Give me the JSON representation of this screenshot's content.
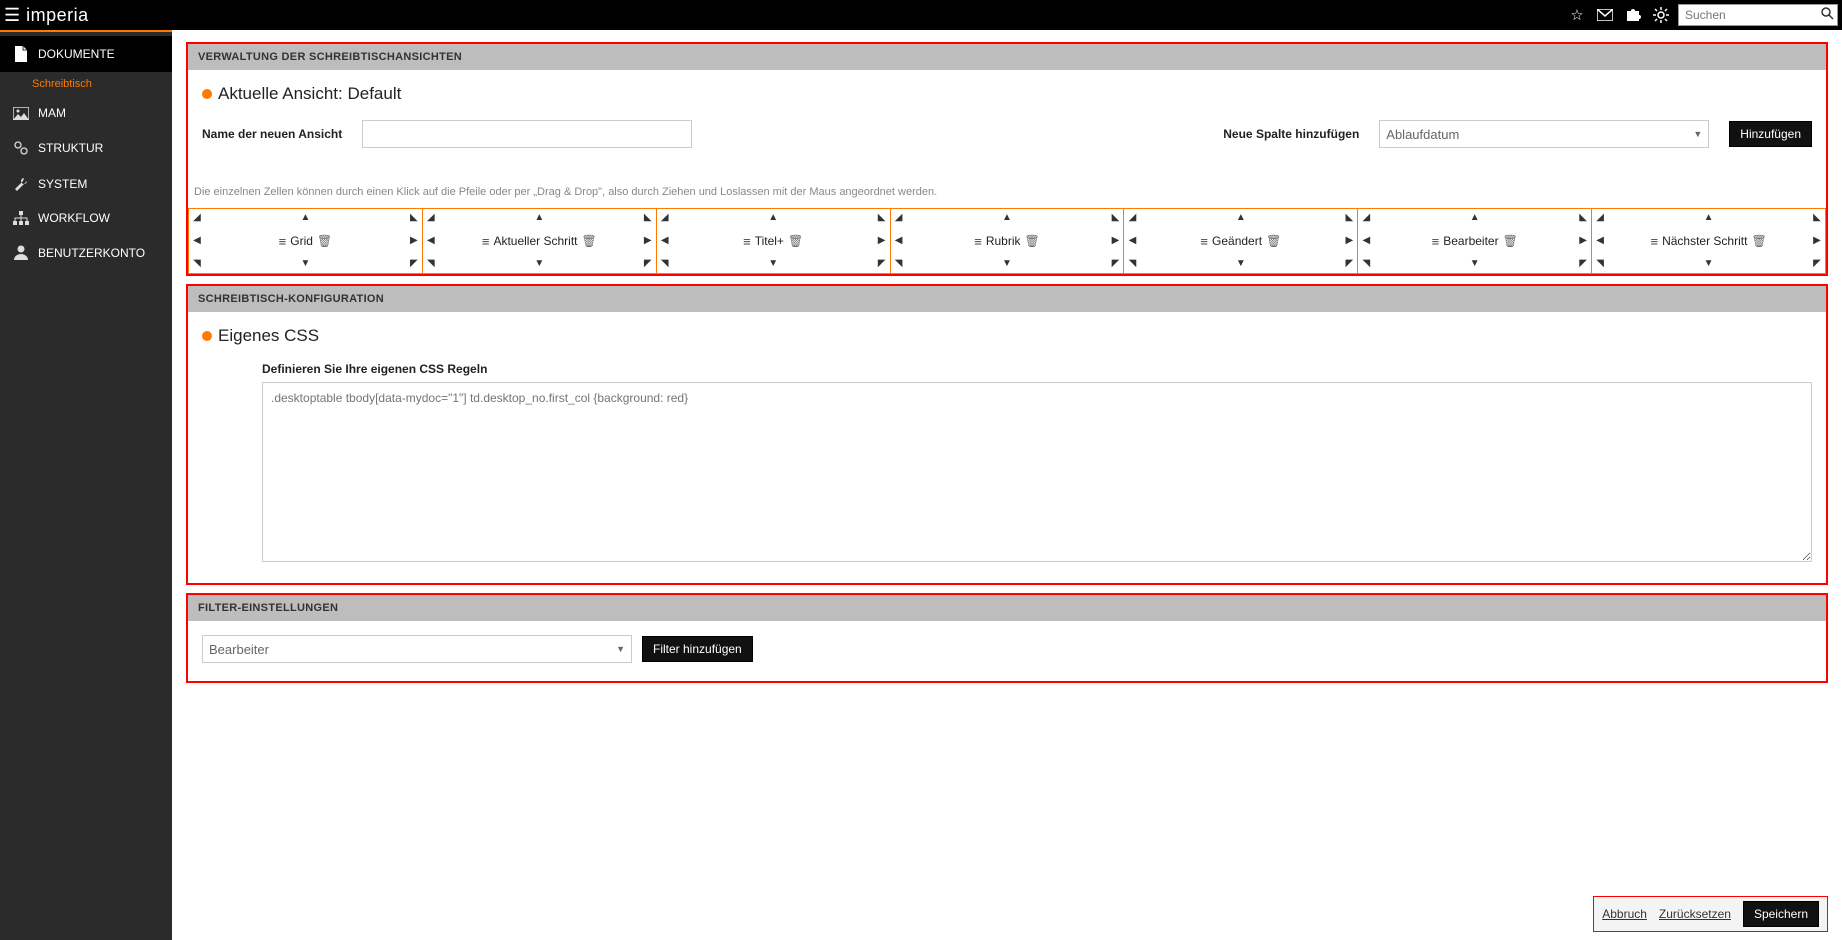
{
  "topbar": {
    "logo": "imperia",
    "search_placeholder": "Suchen"
  },
  "sidebar": {
    "items": [
      {
        "label": "DOKUMENTE",
        "active": true,
        "sub": [
          {
            "label": "Schreibtisch"
          }
        ]
      },
      {
        "label": "MAM"
      },
      {
        "label": "STRUKTUR"
      },
      {
        "label": "SYSTEM"
      },
      {
        "label": "WORKFLOW"
      },
      {
        "label": "BENUTZERKONTO"
      }
    ]
  },
  "sections": {
    "views": {
      "header": "Verwaltung der Schreibtischansichten",
      "title_prefix": "Aktuelle Ansicht: ",
      "current_view": "Default",
      "name_label": "Name der neuen Ansicht",
      "add_col_label": "Neue Spalte hinzufügen",
      "add_col_selected": "Ablaufdatum",
      "add_btn": "Hinzufügen",
      "helper": "Die einzelnen Zellen können durch einen Klick auf die Pfeile oder per „Drag & Drop\", also durch Ziehen und Loslassen mit der Maus angeordnet werden.",
      "columns": [
        "Grid",
        "Aktueller Schritt",
        "Titel+",
        "Rubrik",
        "Geändert",
        "Bearbeiter",
        "Nächster Schritt"
      ]
    },
    "css": {
      "header": "Schreibtisch-Konfiguration",
      "title": "Eigenes CSS",
      "label": "Definieren Sie Ihre eigenen CSS Regeln",
      "placeholder": ".desktoptable tbody[data-mydoc=\"1\"] td.desktop_no.first_col {background: red}"
    },
    "filter": {
      "header": "Filter-Einstellungen",
      "selected": "Bearbeiter",
      "add_btn": "Filter hinzufügen"
    }
  },
  "actions": {
    "cancel": "Abbruch",
    "reset": "Zurücksetzen",
    "save": "Speichern"
  }
}
